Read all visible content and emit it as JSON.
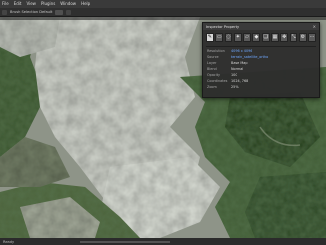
{
  "menubar": {
    "items": [
      {
        "label": "File"
      },
      {
        "label": "Edit"
      },
      {
        "label": "View"
      },
      {
        "label": "Plugins"
      },
      {
        "label": "Window"
      },
      {
        "label": "Help"
      }
    ]
  },
  "toolbar": {
    "label": "Brush Selection Default"
  },
  "panel": {
    "title": "Inspector Property",
    "close_icon": "close-icon",
    "icons": [
      {
        "name": "brush-icon",
        "glyph": "✎",
        "active": true
      },
      {
        "name": "rect-select-icon",
        "glyph": "▭",
        "active": false
      },
      {
        "name": "lasso-icon",
        "glyph": "◌",
        "active": false
      },
      {
        "name": "wand-icon",
        "glyph": "✦",
        "active": false
      },
      {
        "name": "eraser-icon",
        "glyph": "▱",
        "active": false
      },
      {
        "name": "picker-icon",
        "glyph": "◆",
        "active": false
      },
      {
        "name": "layer-icon",
        "glyph": "❏",
        "active": false
      },
      {
        "name": "grid-icon",
        "glyph": "▦",
        "active": false
      },
      {
        "name": "move-icon",
        "glyph": "✥",
        "active": false
      },
      {
        "name": "transform-icon",
        "glyph": "⤡",
        "active": false
      },
      {
        "name": "settings-icon",
        "glyph": "⚙",
        "active": false
      },
      {
        "name": "more-icon",
        "glyph": "⋯",
        "active": false
      }
    ],
    "properties": [
      {
        "label": "Resolution",
        "value": "4096 x 4096",
        "link": true
      },
      {
        "label": "Source",
        "value": "terrain_satellite_ortho",
        "link": true
      },
      {
        "label": "Layer",
        "value": "Base Map",
        "link": false
      },
      {
        "label": "Blend",
        "value": "Normal",
        "link": false
      },
      {
        "label": "Opacity",
        "value": "100",
        "link": false
      },
      {
        "label": "Coordinates",
        "value": "1024, 768",
        "link": false
      },
      {
        "label": "Zoom",
        "value": "25%",
        "link": false
      }
    ]
  },
  "statusbar": {
    "text": "Ready"
  },
  "colors": {
    "snow": "#c9cdc6",
    "rock": "#8f958b",
    "forest": "#3f5a34",
    "forest_dark": "#2c4226",
    "panel_bg": "#2d2d2d",
    "accent_link": "#6fa8ff"
  }
}
